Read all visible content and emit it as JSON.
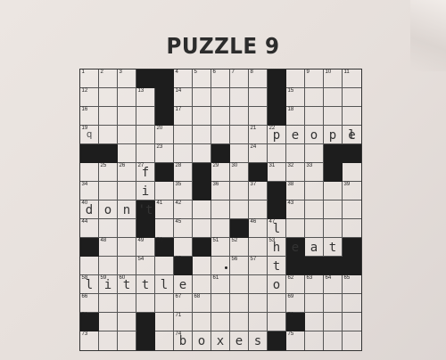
{
  "title": "PUZZLE 9",
  "grid": {
    "rows": 15,
    "cols": 15,
    "blocks": [
      [
        0,
        3
      ],
      [
        0,
        4
      ],
      [
        0,
        10
      ],
      [
        1,
        4
      ],
      [
        1,
        10
      ],
      [
        2,
        4
      ],
      [
        2,
        10
      ],
      [
        4,
        0
      ],
      [
        4,
        1
      ],
      [
        4,
        7
      ],
      [
        4,
        13
      ],
      [
        4,
        14
      ],
      [
        5,
        4
      ],
      [
        5,
        6
      ],
      [
        5,
        9
      ],
      [
        5,
        13
      ],
      [
        6,
        6
      ],
      [
        6,
        10
      ],
      [
        7,
        3
      ],
      [
        7,
        10
      ],
      [
        8,
        3
      ],
      [
        8,
        8
      ],
      [
        9,
        0
      ],
      [
        9,
        4
      ],
      [
        9,
        6
      ],
      [
        9,
        11
      ],
      [
        9,
        14
      ],
      [
        10,
        5
      ],
      [
        10,
        11
      ],
      [
        10,
        12
      ],
      [
        10,
        13
      ],
      [
        10,
        14
      ],
      [
        13,
        0
      ],
      [
        13,
        3
      ],
      [
        13,
        11
      ],
      [
        14,
        3
      ],
      [
        14,
        10
      ]
    ],
    "numbers": [
      [
        0,
        0,
        1
      ],
      [
        0,
        1,
        2
      ],
      [
        0,
        2,
        3
      ],
      [
        0,
        5,
        4
      ],
      [
        0,
        6,
        5
      ],
      [
        0,
        7,
        6
      ],
      [
        0,
        8,
        7
      ],
      [
        0,
        9,
        8
      ],
      [
        0,
        12,
        9
      ],
      [
        0,
        13,
        10
      ],
      [
        0,
        14,
        11
      ],
      [
        1,
        0,
        12
      ],
      [
        1,
        3,
        13
      ],
      [
        1,
        5,
        14
      ],
      [
        1,
        11,
        15
      ],
      [
        2,
        0,
        16
      ],
      [
        2,
        5,
        17
      ],
      [
        2,
        11,
        18
      ],
      [
        3,
        0,
        19
      ],
      [
        3,
        4,
        20
      ],
      [
        3,
        9,
        21
      ],
      [
        3,
        10,
        22
      ],
      [
        4,
        4,
        23
      ],
      [
        4,
        9,
        24
      ],
      [
        5,
        1,
        25
      ],
      [
        5,
        2,
        26
      ],
      [
        5,
        3,
        27
      ],
      [
        5,
        5,
        28
      ],
      [
        5,
        7,
        29
      ],
      [
        5,
        8,
        30
      ],
      [
        5,
        10,
        31
      ],
      [
        5,
        11,
        32
      ],
      [
        5,
        12,
        33
      ],
      [
        6,
        0,
        34
      ],
      [
        6,
        5,
        35
      ],
      [
        6,
        7,
        36
      ],
      [
        6,
        9,
        37
      ],
      [
        6,
        11,
        38
      ],
      [
        6,
        14,
        39
      ],
      [
        7,
        0,
        40
      ],
      [
        7,
        4,
        41
      ],
      [
        7,
        5,
        42
      ],
      [
        7,
        11,
        43
      ],
      [
        8,
        0,
        44
      ],
      [
        8,
        5,
        45
      ],
      [
        8,
        9,
        46
      ],
      [
        8,
        10,
        47
      ],
      [
        9,
        1,
        48
      ],
      [
        9,
        3,
        49
      ],
      [
        9,
        4,
        50
      ],
      [
        9,
        7,
        51
      ],
      [
        9,
        8,
        52
      ],
      [
        9,
        10,
        53
      ],
      [
        10,
        3,
        54
      ],
      [
        10,
        5,
        55
      ],
      [
        10,
        8,
        56
      ],
      [
        10,
        9,
        57
      ],
      [
        11,
        0,
        58
      ],
      [
        11,
        1,
        59
      ],
      [
        11,
        2,
        60
      ],
      [
        11,
        7,
        61
      ],
      [
        11,
        11,
        62
      ],
      [
        11,
        12,
        63
      ],
      [
        11,
        13,
        64
      ],
      [
        11,
        14,
        65
      ],
      [
        12,
        0,
        66
      ],
      [
        12,
        5,
        67
      ],
      [
        12,
        6,
        68
      ],
      [
        12,
        11,
        69
      ],
      [
        13,
        0,
        70
      ],
      [
        13,
        5,
        71
      ],
      [
        13,
        11,
        72
      ],
      [
        14,
        0,
        73
      ],
      [
        14,
        5,
        74
      ],
      [
        14,
        11,
        75
      ]
    ],
    "letters": [
      [
        3,
        0,
        "q",
        true
      ],
      [
        3,
        10,
        "p",
        false
      ],
      [
        3,
        11,
        "e",
        false
      ],
      [
        3,
        12,
        "o",
        false
      ],
      [
        3,
        13,
        "p",
        false
      ],
      [
        3,
        14,
        "l",
        false
      ],
      [
        3,
        15,
        "e",
        false
      ],
      [
        5,
        3,
        "f",
        false
      ],
      [
        6,
        3,
        "i",
        false
      ],
      [
        7,
        0,
        "d",
        false
      ],
      [
        7,
        1,
        "o",
        false
      ],
      [
        7,
        2,
        "n",
        false
      ],
      [
        7,
        3,
        "'t",
        false
      ],
      [
        8,
        10,
        "l",
        false
      ],
      [
        9,
        10,
        "h",
        false
      ],
      [
        9,
        11,
        "e",
        false
      ],
      [
        9,
        12,
        "a",
        false
      ],
      [
        9,
        13,
        "t",
        false
      ],
      [
        10,
        10,
        "t",
        false
      ],
      [
        11,
        0,
        "l",
        false
      ],
      [
        11,
        1,
        "i",
        false
      ],
      [
        11,
        2,
        "t",
        false
      ],
      [
        11,
        3,
        "t",
        false
      ],
      [
        11,
        4,
        "l",
        false
      ],
      [
        11,
        5,
        "e",
        false
      ],
      [
        11,
        10,
        "o",
        false
      ],
      [
        14,
        5,
        "b",
        false
      ],
      [
        14,
        6,
        "o",
        false
      ],
      [
        14,
        7,
        "x",
        false
      ],
      [
        14,
        8,
        "e",
        false
      ],
      [
        14,
        9,
        "s",
        false
      ]
    ]
  }
}
